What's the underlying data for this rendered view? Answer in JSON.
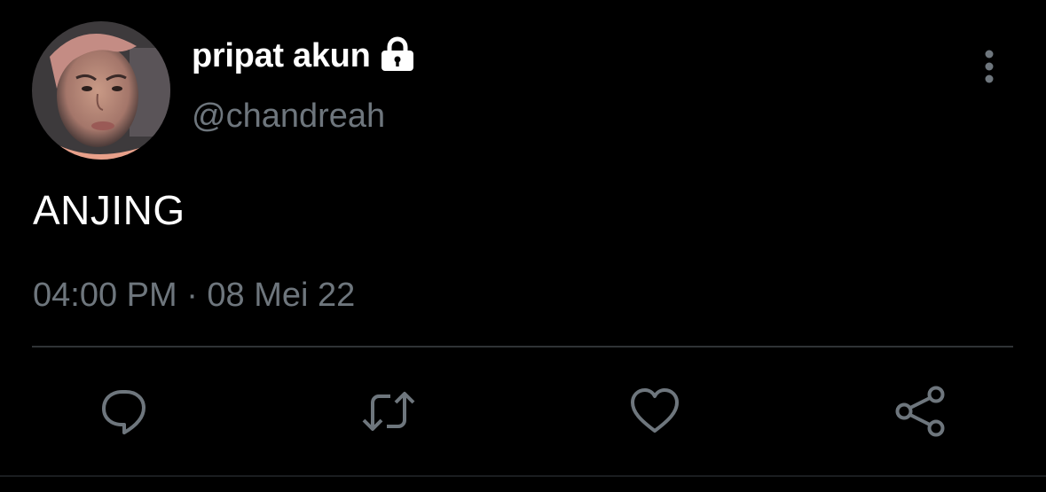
{
  "tweet": {
    "author": {
      "display_name": "pripat akun",
      "handle": "@chandreah",
      "protected_icon": "lock-icon",
      "avatar_icon": "avatar-photo"
    },
    "text": "ANJING",
    "timestamp": "04:00 PM · 08 Mei 22",
    "more_icon": "more-vertical-icon"
  },
  "actions": [
    {
      "name": "reply",
      "icon": "reply-icon"
    },
    {
      "name": "retweet",
      "icon": "retweet-icon"
    },
    {
      "name": "like",
      "icon": "heart-icon"
    },
    {
      "name": "share",
      "icon": "share-icon"
    }
  ],
  "colors": {
    "background": "#000000",
    "primary_text": "#ffffff",
    "secondary_text": "#6e767d",
    "icon": "#6e767d",
    "divider": "#2f3336"
  }
}
